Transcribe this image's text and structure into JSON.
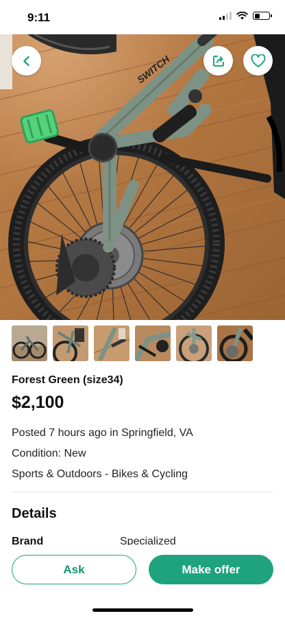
{
  "status_bar": {
    "time": "9:11",
    "signal_bars_active": 2,
    "signal_bars_total": 4,
    "battery_level": 0.35
  },
  "hero": {
    "back_icon": "chevron-left-icon",
    "share_icon": "share-icon",
    "favorite_icon": "heart-icon",
    "frame_text": "SWITCH",
    "photo_count": 6
  },
  "listing": {
    "title": "Forest Green (size34)",
    "price": "$2,100",
    "posted": "Posted 7 hours ago in Springfield, VA",
    "condition": "Condition: New",
    "category": "Sports & Outdoors - Bikes & Cycling"
  },
  "details": {
    "heading": "Details",
    "rows": [
      {
        "key": "Brand",
        "value": "Specialized"
      }
    ]
  },
  "actions": {
    "ask_label": "Ask",
    "offer_label": "Make offer"
  },
  "colors": {
    "accent": "#1fa37e",
    "floor": "#b77a45",
    "frame": "#7d9285"
  }
}
